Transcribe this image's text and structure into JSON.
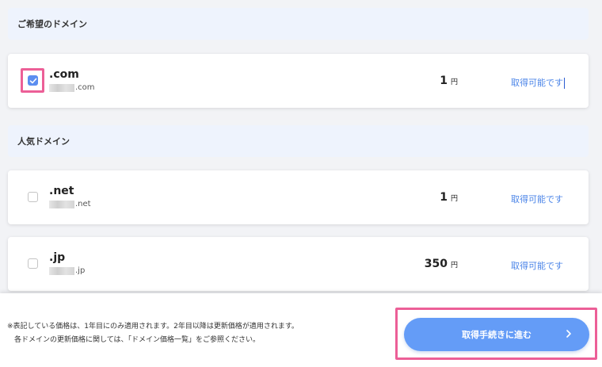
{
  "sections": {
    "desired": {
      "title": "ご希望のドメイン"
    },
    "popular": {
      "title": "人気ドメイン"
    }
  },
  "domains": [
    {
      "tld": ".com",
      "suffix": ".com",
      "price": "1",
      "unit": "円",
      "status": "取得可能です",
      "checked": true
    },
    {
      "tld": ".net",
      "suffix": ".net",
      "price": "1",
      "unit": "円",
      "status": "取得可能です",
      "checked": false
    },
    {
      "tld": ".jp",
      "suffix": ".jp",
      "price": "350",
      "unit": "円",
      "status": "取得可能です",
      "checked": false
    }
  ],
  "footer": {
    "note_line1": "※表記している価格は、1年目にのみ適用されます。2年目以降は更新価格が適用されます。",
    "note_line2": "各ドメインの更新価格に関しては、「ドメイン価格一覧」をご参照ください。",
    "proceed_label": "取得手続きに進む"
  },
  "colors": {
    "accent": "#649cf7",
    "status": "#4d86e8",
    "highlight": "#ec5f97",
    "section_bg": "#eef3fd"
  }
}
